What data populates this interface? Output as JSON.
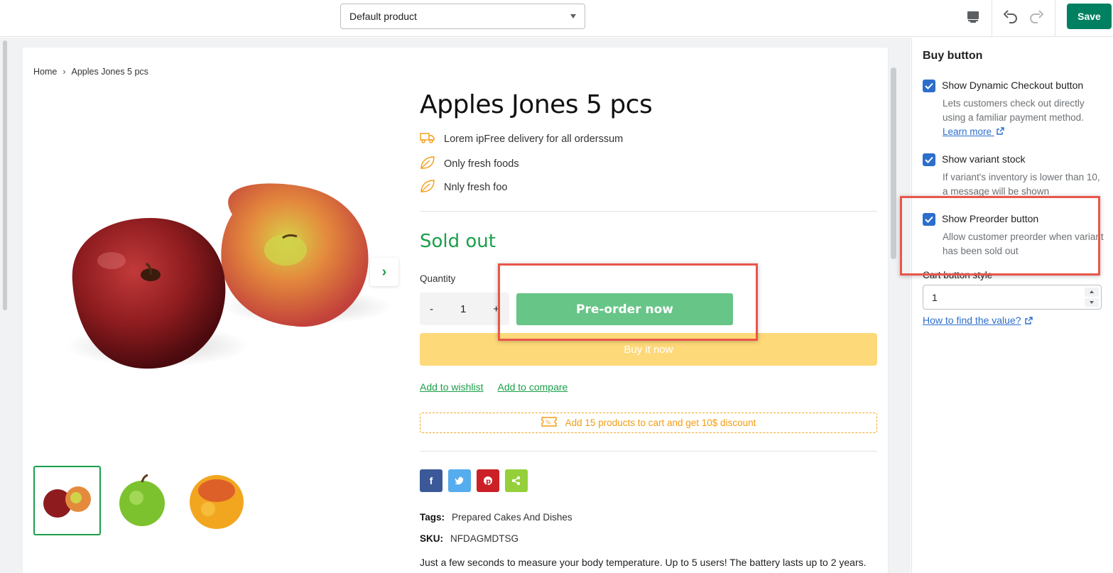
{
  "toolbar": {
    "product_select": "Default product",
    "save_label": "Save",
    "icons": [
      "desktop-icon",
      "undo-icon",
      "redo-icon"
    ]
  },
  "breadcrumb": {
    "home": "Home",
    "separator": "›",
    "current": "Apples Jones 5 pcs"
  },
  "product": {
    "title": "Apples Jones 5 pcs",
    "features": [
      "Lorem ipFree delivery for all orderssum",
      "Only fresh foods",
      "Nnly fresh foo"
    ],
    "status": "Sold out",
    "quantity_label": "Quantity",
    "quantity_minus": "-",
    "quantity_value": "1",
    "quantity_plus": "+",
    "preorder_label": "Pre-order now",
    "buy_now_label": "Buy it now",
    "wishlist_label": "Add to wishlist",
    "compare_label": "Add to compare",
    "discount_text": "Add 15 products to cart and get 10$ discount",
    "tags_label": "Tags:",
    "tags_value": "Prepared Cakes And Dishes",
    "sku_label": "SKU:",
    "sku_value": "NFDAGMDTSG",
    "description": "Just a few seconds to measure your body temperature. Up to 5 users! The battery lasts up to 2 years.",
    "social": [
      "facebook-icon",
      "twitter-icon",
      "pinterest-icon",
      "share-icon"
    ]
  },
  "panel": {
    "title": "Buy button",
    "options": [
      {
        "label": "Show Dynamic Checkout button",
        "checked": true,
        "help": "Lets customers check out directly using a familiar payment method.",
        "link": "Learn more"
      },
      {
        "label": "Show variant stock",
        "checked": true,
        "help": "If variant's inventory is lower than 10, a message will be shown"
      },
      {
        "label": "Show Preorder button",
        "checked": true,
        "help": "Allow customer preorder when variant has been sold out"
      }
    ],
    "cart_style_label": "Cart button style",
    "cart_style_value": "1",
    "how_link": "How to find the value?"
  },
  "colors": {
    "accent_green": "#1a9f4a",
    "save_green": "#008060",
    "checkbox_blue": "#2c6ecb",
    "highlight_red": "#e9564b",
    "buy_now_yellow": "#fed979"
  }
}
